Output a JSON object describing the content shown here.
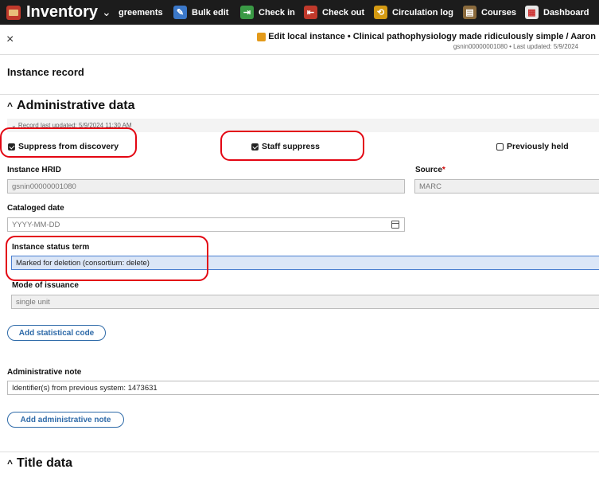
{
  "app": {
    "name": "Inventory",
    "caret": "⌄"
  },
  "nav": [
    {
      "label": "greements",
      "icon": "",
      "color": ""
    },
    {
      "label": "Bulk edit",
      "icon": "✎",
      "color": "#3b78c9"
    },
    {
      "label": "Check in",
      "icon": "⇥",
      "color": "#3a9a45"
    },
    {
      "label": "Check out",
      "icon": "⇤",
      "color": "#c0392b"
    },
    {
      "label": "Circulation log",
      "icon": "⟲",
      "color": "#d49a12"
    },
    {
      "label": "Courses",
      "icon": "▤",
      "color": "#8a6a3c"
    },
    {
      "label": "Dashboard",
      "icon": "▦",
      "color": "#e8e8e8"
    }
  ],
  "header": {
    "close": "×",
    "title": "Edit local instance • Clinical pathophysiology made ridiculously simple / Aaron",
    "subtitle": "gsnin00000001080 • Last updated: 5/9/2024"
  },
  "record": {
    "heading": "Instance record",
    "admin_heading": "Administrative data",
    "collapse_icon": "^",
    "last_updated": "⌄ Record last updated: 5/9/2024 11:30 AM",
    "suppress_discovery": {
      "label": "Suppress from discovery",
      "checked": true
    },
    "staff_suppress": {
      "label": "Staff suppress",
      "checked": true
    },
    "previously_held": {
      "label": "Previously held",
      "checked": false
    },
    "hrid": {
      "label": "Instance HRID",
      "value": "gsnin00000001080"
    },
    "source": {
      "label": "Source",
      "required": "*",
      "value": "MARC"
    },
    "cataloged": {
      "label": "Cataloged date",
      "placeholder": "YYYY-MM-DD"
    },
    "status_term": {
      "label": "Instance status term",
      "value": "Marked for deletion (consortium: delete)"
    },
    "mode": {
      "label": "Mode of issuance",
      "value": "single unit"
    },
    "add_stat": "Add statistical code",
    "admin_note": {
      "label": "Administrative note",
      "value": "Identifier(s) from previous system: 1473631"
    },
    "add_admin_note": "Add administrative note",
    "title_heading": "Title data"
  },
  "colors": {
    "annotation": "#e30613",
    "accent": "#2e6aa8"
  }
}
